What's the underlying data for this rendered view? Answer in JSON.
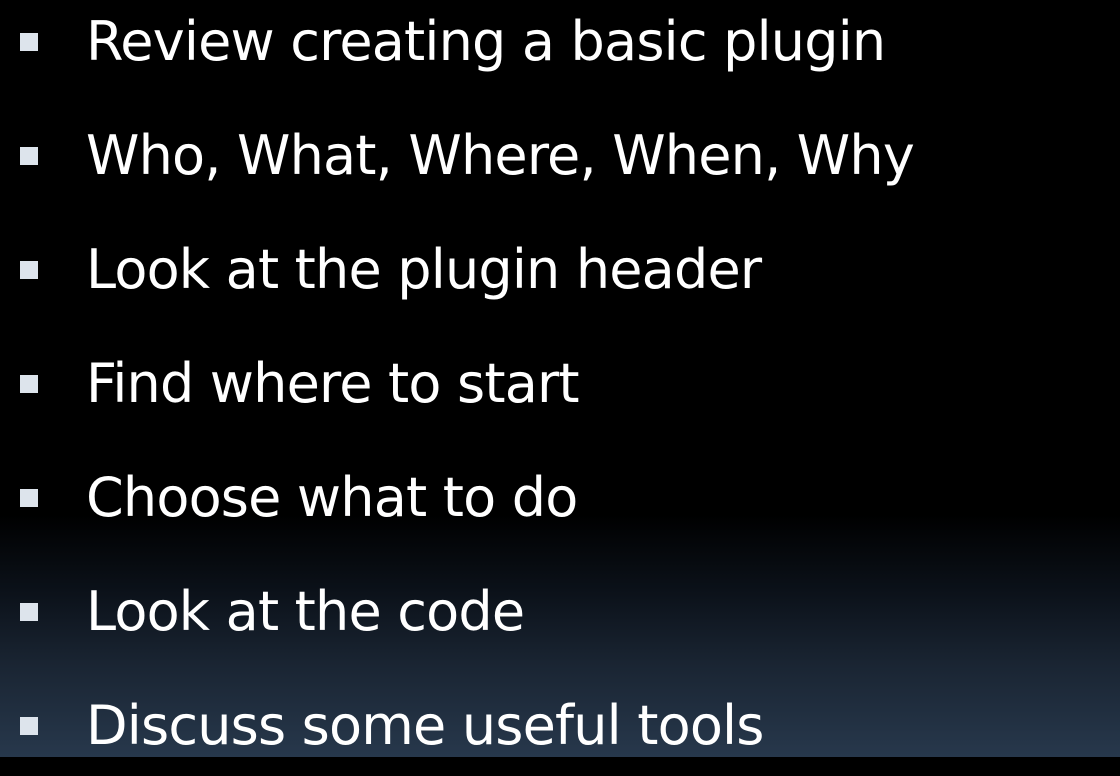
{
  "slide": {
    "bullets": [
      "Review creating a basic plugin",
      "Who, What, Where, When, Why",
      "Look at the plugin header",
      "Find where to start",
      "Choose what to do",
      "Look at the code",
      "Discuss some useful tools"
    ],
    "colors": {
      "background_top": "#000000",
      "background_bottom": "#27384c",
      "text": "#ffffff",
      "bullet_marker": "#dde4ec"
    }
  }
}
